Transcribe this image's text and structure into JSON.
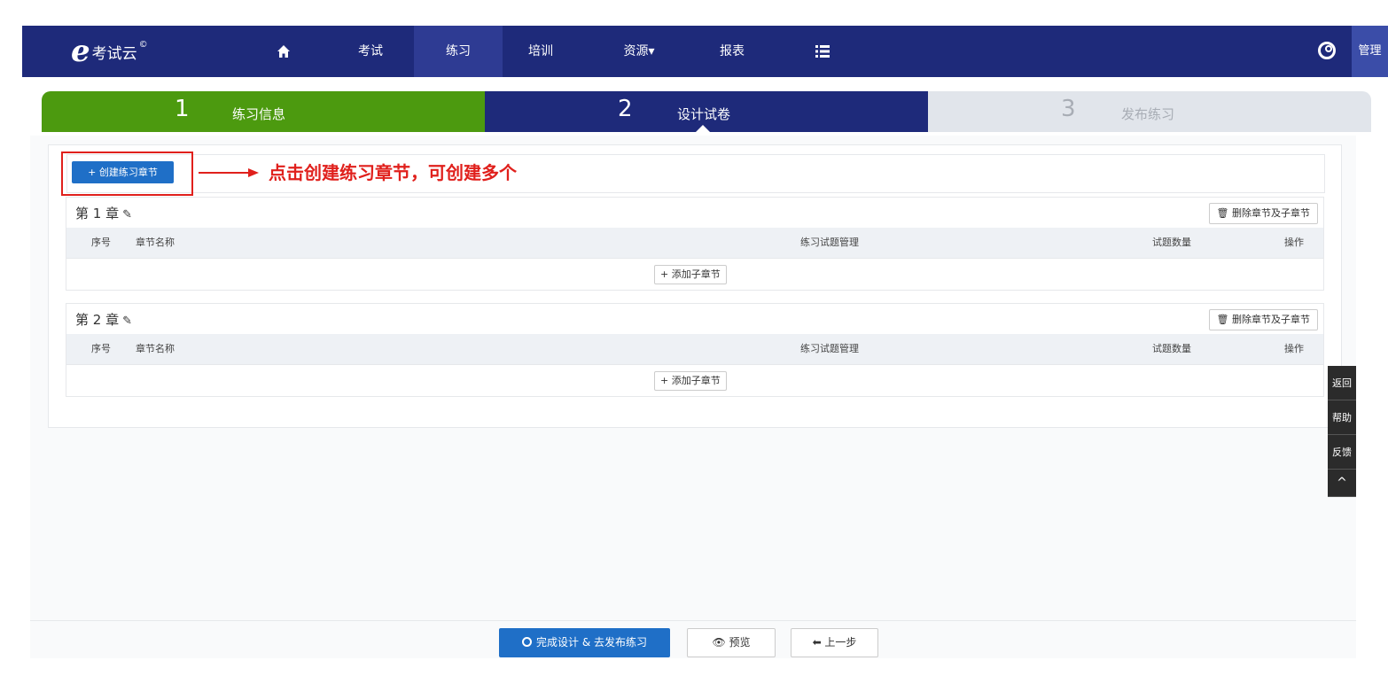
{
  "nav": {
    "logo_mark": "e",
    "logo_text": "考试云",
    "logo_copyright": "©",
    "home_icon": "home-icon",
    "items": [
      {
        "label": "考试"
      },
      {
        "label": "练习"
      },
      {
        "label": "培训"
      },
      {
        "label": "资源▾"
      },
      {
        "label": "报表"
      }
    ],
    "menu_icon": "list-icon",
    "user_icon": "user-icon",
    "admin_label": "管理"
  },
  "steps": [
    {
      "num": "1",
      "label": "练习信息"
    },
    {
      "num": "2",
      "label": "设计试卷"
    },
    {
      "num": "3",
      "label": "发布练习"
    }
  ],
  "toolbar": {
    "create_label": "+ 创建练习章节"
  },
  "annotation": "点击创建练习章节，可创建多个",
  "chapters": [
    {
      "title": "第 1 章",
      "delete_label": "🗑 删除章节及子章节",
      "columns": [
        "序号",
        "章节名称",
        "练习试题管理",
        "试题数量",
        "操作"
      ],
      "add_sub_label": "+ 添加子章节"
    },
    {
      "title": "第 2 章",
      "delete_label": "🗑 删除章节及子章节",
      "columns": [
        "序号",
        "章节名称",
        "练习试题管理",
        "试题数量",
        "操作"
      ],
      "add_sub_label": "+ 添加子章节"
    }
  ],
  "side_tools": [
    "返回",
    "帮助",
    "反馈",
    "^"
  ],
  "footer": {
    "finish_label": "完成设计 & 去发布练习",
    "preview_label": "👁 预览",
    "prev_label": "⬅ 上一步"
  },
  "colors": {
    "nav_bg": "#1e2a7a",
    "step_done": "#4c9a0f",
    "step_active": "#1e2a7a",
    "step_todo": "#e1e5eb",
    "primary_btn": "#1f6fc7",
    "annotation_red": "#e0201c"
  }
}
